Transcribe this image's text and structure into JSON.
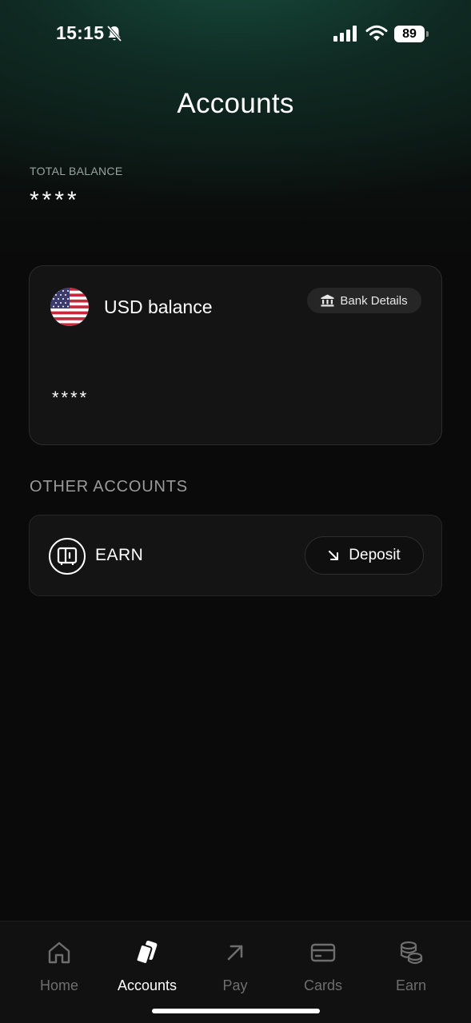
{
  "status_bar": {
    "time": "15:15",
    "battery": "89",
    "icons": [
      "bell-slash-icon",
      "signal-icon",
      "wifi-icon",
      "battery-icon"
    ]
  },
  "header": {
    "title": "Accounts"
  },
  "total_balance": {
    "label": "TOTAL BALANCE",
    "value": "****"
  },
  "usd_card": {
    "title": "USD balance",
    "flag_icon": "us-flag-icon",
    "bank_details_label": "Bank Details",
    "value": "****"
  },
  "other_accounts": {
    "label": "OTHER ACCOUNTS",
    "items": [
      {
        "title": "EARN",
        "icon": "vault-icon",
        "action_label": "Deposit",
        "action_icon": "arrow-down-right-icon"
      }
    ]
  },
  "tab_bar": {
    "items": [
      {
        "label": "Home",
        "icon": "home-icon",
        "active": false
      },
      {
        "label": "Accounts",
        "icon": "cards-icon",
        "active": true
      },
      {
        "label": "Pay",
        "icon": "arrow-up-right-icon",
        "active": false
      },
      {
        "label": "Cards",
        "icon": "credit-card-icon",
        "active": false
      },
      {
        "label": "Earn",
        "icon": "coins-icon",
        "active": false
      }
    ]
  },
  "colors": {
    "background": "#0a0a0a",
    "header_glow": "#174a3a",
    "card": "#141414",
    "muted_text": "#9a9a9a",
    "inactive_tab": "#6e6e6e"
  }
}
